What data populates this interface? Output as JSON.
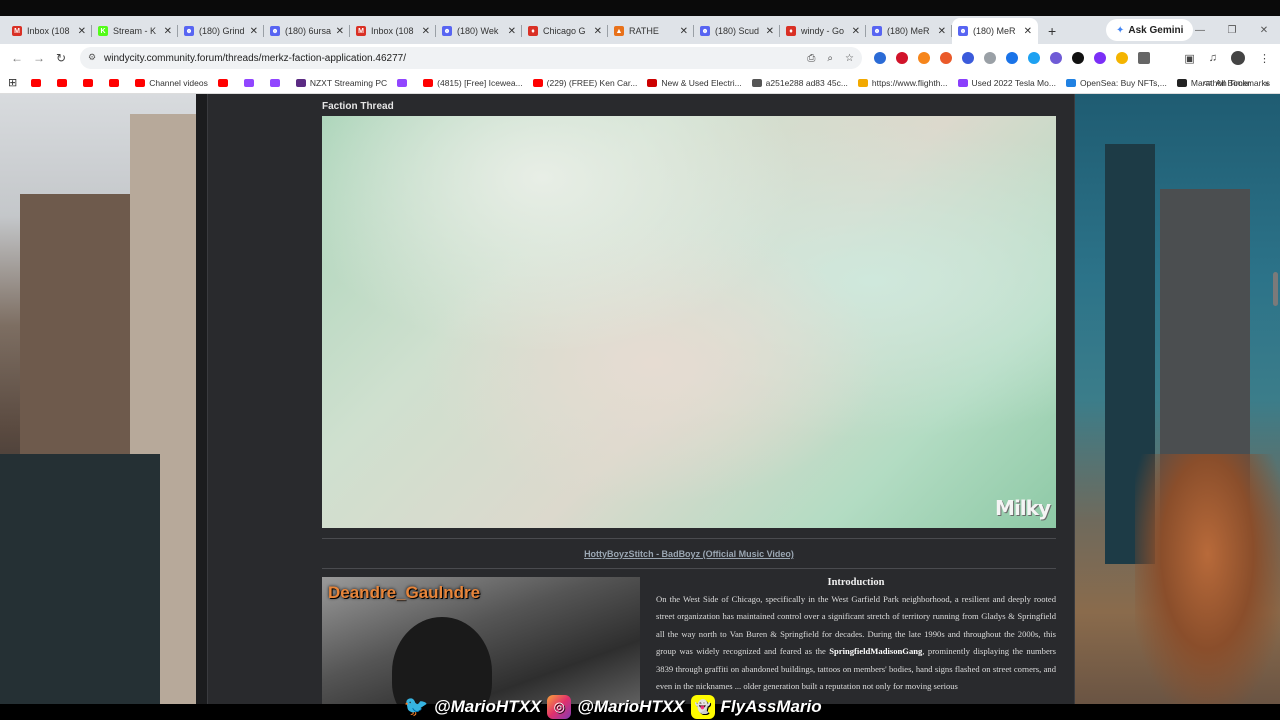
{
  "browser": {
    "tabs": [
      {
        "label": "Inbox (108",
        "icon_color": "#d93025",
        "icon_char": "M"
      },
      {
        "label": "Stream - K",
        "icon_color": "#53fc18",
        "icon_char": "K"
      },
      {
        "label": "(180) Grind",
        "icon_color": "#5865f2",
        "icon_char": "☻"
      },
      {
        "label": "(180) 6ursa",
        "icon_color": "#5865f2",
        "icon_char": "☻"
      },
      {
        "label": "Inbox (108",
        "icon_color": "#d93025",
        "icon_char": "M"
      },
      {
        "label": "(180) Wek",
        "icon_color": "#5865f2",
        "icon_char": "☻"
      },
      {
        "label": "Chicago G",
        "icon_color": "#d93025",
        "icon_char": "♦"
      },
      {
        "label": "RATHE",
        "icon_color": "#e8711a",
        "icon_char": "▲"
      },
      {
        "label": "(180) Scud",
        "icon_color": "#5865f2",
        "icon_char": "☻"
      },
      {
        "label": "windy - Go",
        "icon_color": "#d93025",
        "icon_char": "♦"
      },
      {
        "label": "(180) MeR",
        "icon_color": "#5865f2",
        "icon_char": "☻"
      },
      {
        "label": "(180) MeR",
        "icon_color": "#5865f2",
        "icon_char": "☻",
        "active": true
      }
    ],
    "new_tab_label": "+",
    "gemini_label": "Ask Gemini",
    "url": "windycity.community.forum/threads/merkz-faction-application.46277/",
    "bookmarks": [
      {
        "label": "",
        "color": "#ff0000"
      },
      {
        "label": "",
        "color": "#ff0000"
      },
      {
        "label": "",
        "color": "#ff0000"
      },
      {
        "label": "",
        "color": "#ff0000"
      },
      {
        "label": "Channel videos",
        "color": "#ff0000"
      },
      {
        "label": "",
        "color": "#ff0000"
      },
      {
        "label": "",
        "color": "#9146ff"
      },
      {
        "label": "",
        "color": "#9146ff"
      },
      {
        "label": "NZXT Streaming PC",
        "color": "#5b2b83"
      },
      {
        "label": "",
        "color": "#9146ff"
      },
      {
        "label": "(4815) [Free] Icewea...",
        "color": "#ff0000"
      },
      {
        "label": "(229) (FREE) Ken Car...",
        "color": "#ff0000"
      },
      {
        "label": "New & Used Electri...",
        "color": "#cc0000"
      },
      {
        "label": "a251e288 ad83 45c...",
        "color": "#555555"
      },
      {
        "label": "https://www.flighth...",
        "color": "#f2a900"
      },
      {
        "label": "Used 2022 Tesla Mo...",
        "color": "#8a3ffc"
      },
      {
        "label": "OpenSea: Buy NFTs,...",
        "color": "#2081e2"
      },
      {
        "label": "Marathon Timer",
        "color": "#222222"
      }
    ],
    "all_bookmarks_label": "All Bookmarks"
  },
  "post": {
    "section_title": "Faction Thread",
    "video_watermark": "Milky",
    "video_link": "HottyBoyzStitch - BadBoyz (Official Music Video)",
    "photo_caption": "Deandre_Gaulndre",
    "intro_heading": "Introduction",
    "intro_text_1": "On the West Side of Chicago, specifically in the West Garfield Park neighborhood, a resilient and deeply rooted street organization has maintained control over a significant stretch of territory running from Gladys & Springfield all the way north to Van Buren & Springfield for decades. During the late 1990s and throughout the 2000s, this group was widely recognized and feared as the ",
    "intro_bold": "SpringfieldMadisonGang",
    "intro_text_2": ", prominently displaying the numbers 3839 through graffiti on abandoned buildings, tattoos on members' bodies, hand signs flashed on street corners, and even in the nicknames ... older generation built a reputation not only for moving serious"
  },
  "overlay": {
    "twitter_handle": "@MarioHTXX",
    "instagram_handle": "@MarioHTXX",
    "snapchat_handle": "FlyAssMario"
  }
}
